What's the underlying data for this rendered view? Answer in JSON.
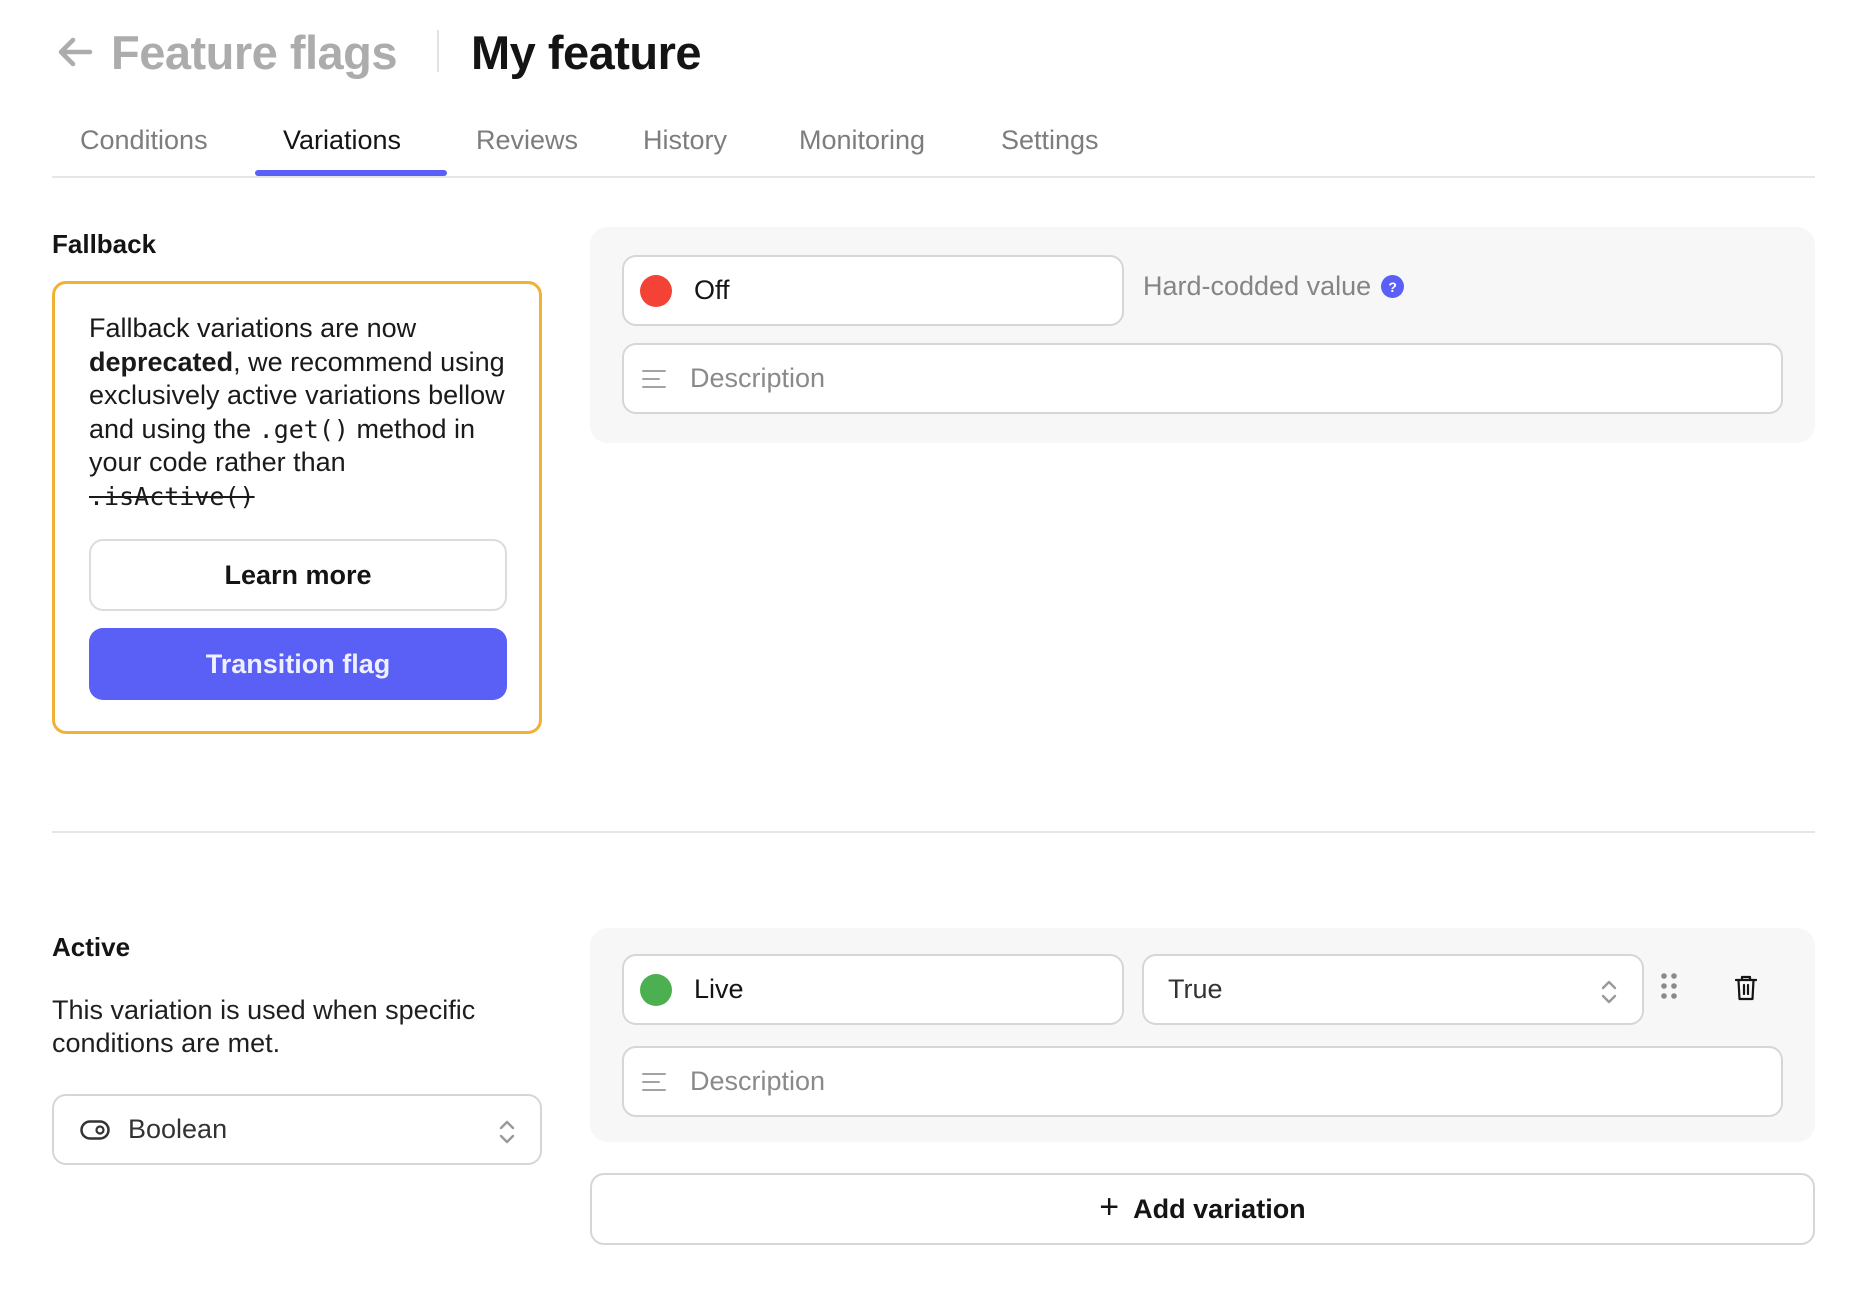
{
  "header": {
    "back_icon": "arrow-left-icon",
    "breadcrumb_parent": "Feature flags",
    "title": "My feature"
  },
  "tabs": [
    {
      "label": "Conditions",
      "active": false
    },
    {
      "label": "Variations",
      "active": true
    },
    {
      "label": "Reviews",
      "active": false
    },
    {
      "label": "History",
      "active": false
    },
    {
      "label": "Monitoring",
      "active": false
    },
    {
      "label": "Settings",
      "active": false
    }
  ],
  "fallback": {
    "label": "Fallback",
    "warning": {
      "text_1": "Fallback variations are now ",
      "bold": "deprecated",
      "text_2": ", we recommend using exclusively active variations bellow and using the ",
      "code_1": ".get()",
      "text_3": " method in your code rather than ",
      "code_strike": ".isActive()",
      "learn_more_label": "Learn more",
      "transition_label": "Transition flag",
      "border_color": "#f2b134"
    },
    "variation": {
      "name": "Off",
      "status_color": "#f44336",
      "hint": "Hard-codded value",
      "help_icon": "question-circle-icon",
      "description_placeholder": "Description",
      "description_icon": "text-lines-icon"
    }
  },
  "active": {
    "label": "Active",
    "description": "This variation is used when specific conditions are met.",
    "type_select": {
      "icon": "toggle-icon",
      "value": "Boolean"
    },
    "variations": [
      {
        "name": "Live",
        "status_color": "#4caf50",
        "value": "True",
        "description_placeholder": "Description",
        "description_icon": "text-lines-icon",
        "drag_icon": "drag-handle-icon",
        "delete_icon": "trash-icon"
      }
    ],
    "add_label": "Add variation",
    "add_icon": "plus-icon"
  },
  "colors": {
    "accent": "#5a5ff6",
    "panel_bg": "#f7f7f7",
    "border": "#d6d6d6"
  }
}
